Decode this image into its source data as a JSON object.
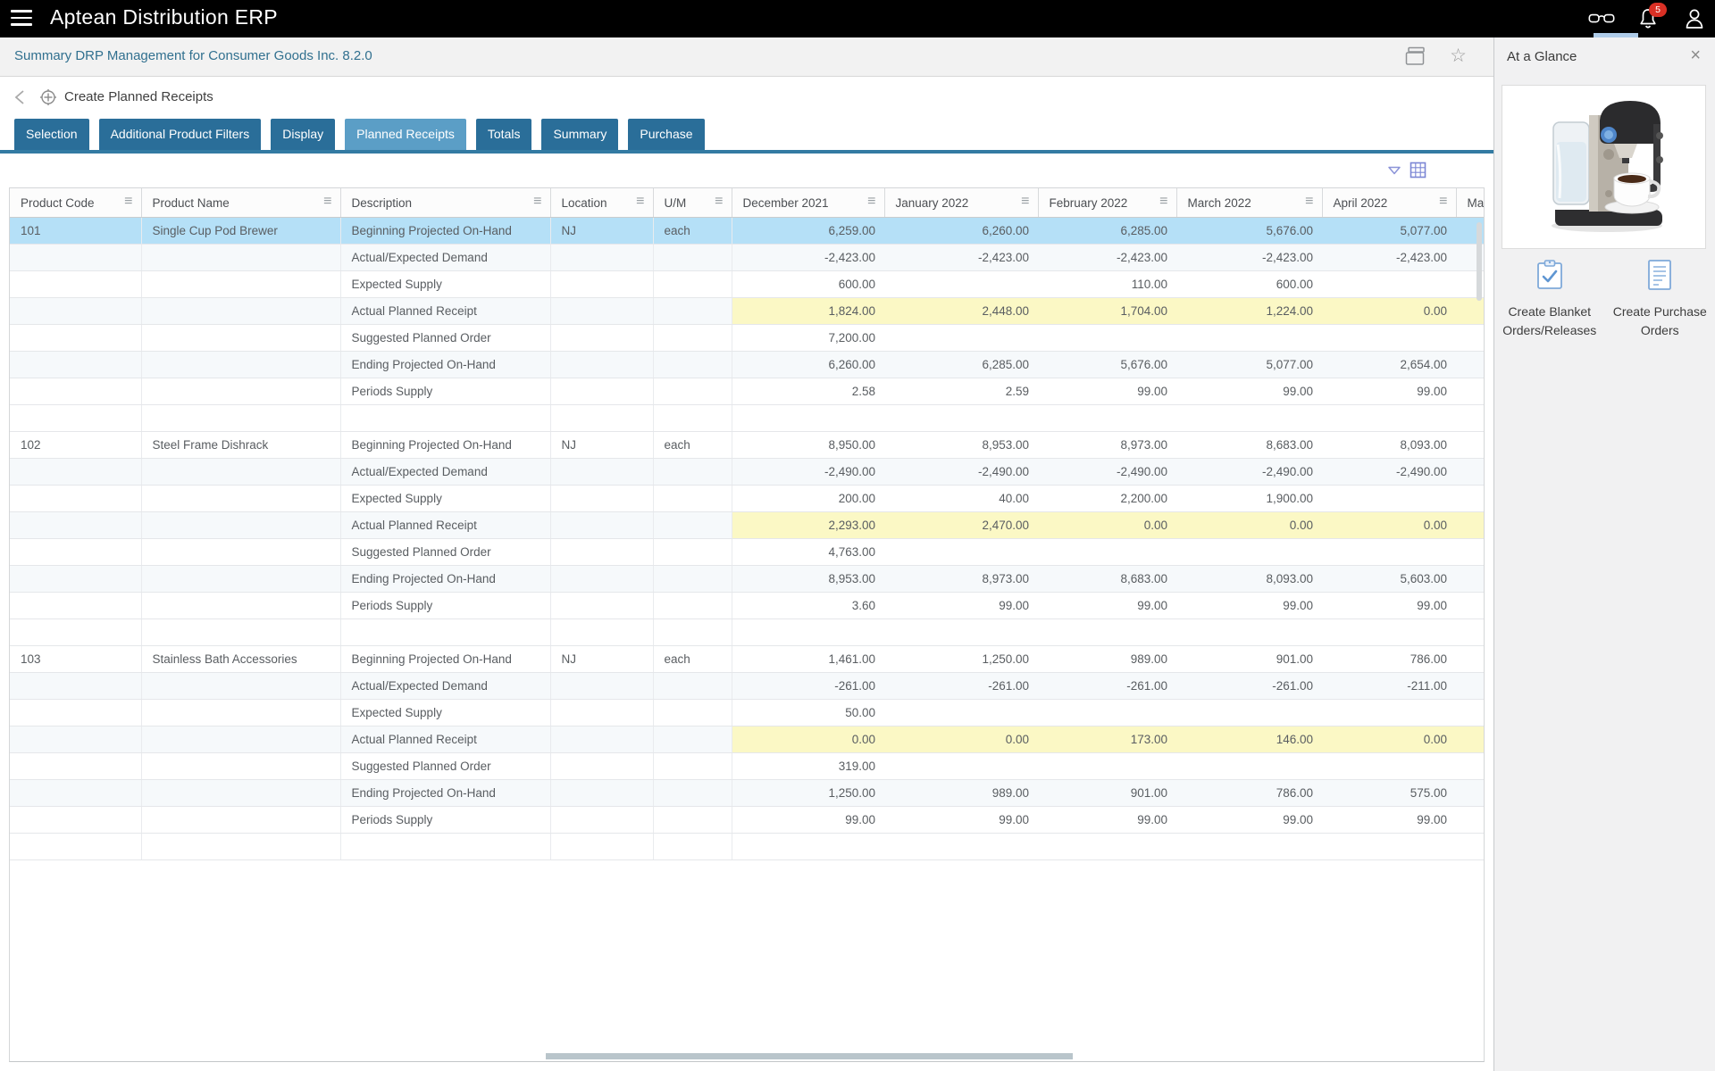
{
  "app": {
    "title": "Aptean Distribution ERP"
  },
  "topbar": {
    "notification_count": "5"
  },
  "titlebar": {
    "link": "Summary DRP Management for Consumer Goods Inc. 8.2.0"
  },
  "nav": {
    "title": "Create Planned Receipts"
  },
  "tabs": [
    {
      "label": "Selection",
      "active": false
    },
    {
      "label": "Additional Product Filters",
      "active": false
    },
    {
      "label": "Display",
      "active": false
    },
    {
      "label": "Planned Receipts",
      "active": true
    },
    {
      "label": "Totals",
      "active": false
    },
    {
      "label": "Summary",
      "active": false
    },
    {
      "label": "Purchase",
      "active": false
    }
  ],
  "table": {
    "columns": [
      "Product Code",
      "Product Name",
      "Description",
      "Location",
      "U/M",
      "December 2021",
      "January 2022",
      "February 2022",
      "March 2022",
      "April 2022",
      "May"
    ],
    "products": [
      {
        "code": "101",
        "name": "Single Cup Pod Brewer",
        "location": "NJ",
        "uom": "each",
        "rows": [
          {
            "description": "Beginning Projected On-Hand",
            "values": [
              "6,259.00",
              "6,260.00",
              "6,285.00",
              "5,676.00",
              "5,077.00"
            ],
            "selected": true
          },
          {
            "description": "Actual/Expected Demand",
            "values": [
              "-2,423.00",
              "-2,423.00",
              "-2,423.00",
              "-2,423.00",
              "-2,423.00"
            ]
          },
          {
            "description": "Expected Supply",
            "values": [
              "600.00",
              "",
              "110.00",
              "600.00",
              ""
            ]
          },
          {
            "description": "Actual Planned Receipt",
            "values": [
              "1,824.00",
              "2,448.00",
              "1,704.00",
              "1,224.00",
              "0.00"
            ],
            "highlight": true
          },
          {
            "description": "Suggested Planned Order",
            "values": [
              "7,200.00",
              "",
              "",
              "",
              ""
            ]
          },
          {
            "description": "Ending Projected On-Hand",
            "values": [
              "6,260.00",
              "6,285.00",
              "5,676.00",
              "5,077.00",
              "2,654.00"
            ]
          },
          {
            "description": "Periods Supply",
            "values": [
              "2.58",
              "2.59",
              "99.00",
              "99.00",
              "99.00"
            ]
          }
        ]
      },
      {
        "code": "102",
        "name": "Steel Frame Dishrack",
        "location": "NJ",
        "uom": "each",
        "rows": [
          {
            "description": "Beginning Projected On-Hand",
            "values": [
              "8,950.00",
              "8,953.00",
              "8,973.00",
              "8,683.00",
              "8,093.00"
            ]
          },
          {
            "description": "Actual/Expected Demand",
            "values": [
              "-2,490.00",
              "-2,490.00",
              "-2,490.00",
              "-2,490.00",
              "-2,490.00"
            ]
          },
          {
            "description": "Expected Supply",
            "values": [
              "200.00",
              "40.00",
              "2,200.00",
              "1,900.00",
              ""
            ]
          },
          {
            "description": "Actual Planned Receipt",
            "values": [
              "2,293.00",
              "2,470.00",
              "0.00",
              "0.00",
              "0.00"
            ],
            "highlight": true
          },
          {
            "description": "Suggested Planned Order",
            "values": [
              "4,763.00",
              "",
              "",
              "",
              ""
            ]
          },
          {
            "description": "Ending Projected On-Hand",
            "values": [
              "8,953.00",
              "8,973.00",
              "8,683.00",
              "8,093.00",
              "5,603.00"
            ]
          },
          {
            "description": "Periods Supply",
            "values": [
              "3.60",
              "99.00",
              "99.00",
              "99.00",
              "99.00"
            ]
          }
        ]
      },
      {
        "code": "103",
        "name": "Stainless Bath Accessories",
        "location": "NJ",
        "uom": "each",
        "rows": [
          {
            "description": "Beginning Projected On-Hand",
            "values": [
              "1,461.00",
              "1,250.00",
              "989.00",
              "901.00",
              "786.00"
            ]
          },
          {
            "description": "Actual/Expected Demand",
            "values": [
              "-261.00",
              "-261.00",
              "-261.00",
              "-261.00",
              "-211.00"
            ]
          },
          {
            "description": "Expected Supply",
            "values": [
              "50.00",
              "",
              "",
              "",
              ""
            ]
          },
          {
            "description": "Actual Planned Receipt",
            "values": [
              "0.00",
              "0.00",
              "173.00",
              "146.00",
              "0.00"
            ],
            "highlight": true
          },
          {
            "description": "Suggested Planned Order",
            "values": [
              "319.00",
              "",
              "",
              "",
              ""
            ]
          },
          {
            "description": "Ending Projected On-Hand",
            "values": [
              "1,250.00",
              "989.00",
              "901.00",
              "786.00",
              "575.00"
            ]
          },
          {
            "description": "Periods Supply",
            "values": [
              "99.00",
              "99.00",
              "99.00",
              "99.00",
              "99.00"
            ]
          }
        ]
      }
    ]
  },
  "panel": {
    "title": "At a Glance",
    "actions": [
      {
        "label": "Create Blanket Orders/Releases"
      },
      {
        "label": "Create Purchase Orders"
      }
    ]
  },
  "colors": {
    "tab_inactive": "#2a6e99",
    "tab_active": "#5b9ec6",
    "tab_underline": "#337ba3",
    "selected_row": "#b5e0f7",
    "highlight_yellow": "#fbf8c5",
    "badge_red": "#d93025",
    "link_blue": "#31708f"
  }
}
